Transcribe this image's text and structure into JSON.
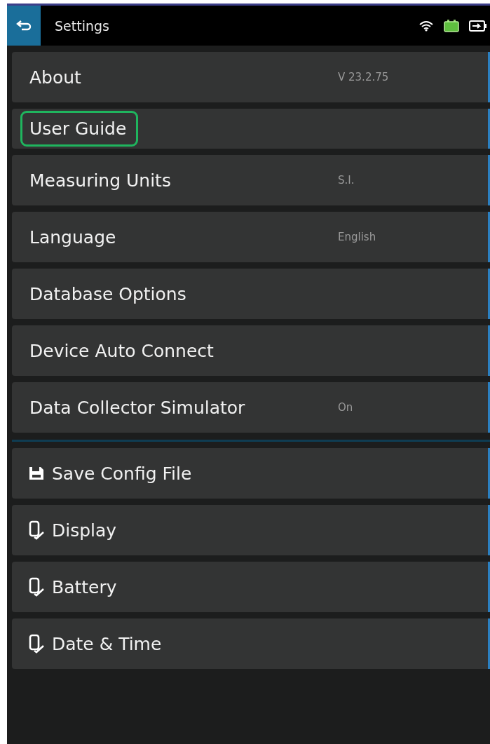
{
  "header": {
    "title": "Settings"
  },
  "settings": [
    {
      "label": "About",
      "value": "V 23.2.75",
      "selected": false
    },
    {
      "label": "User Guide",
      "selected": true
    },
    {
      "label": "Measuring Units",
      "value": "S.I.",
      "selected": false
    },
    {
      "label": "Language",
      "value": "English",
      "selected": false
    },
    {
      "label": "Database Options",
      "selected": false
    },
    {
      "label": "Device Auto Connect",
      "selected": false
    },
    {
      "label": "Data Collector Simulator",
      "value": "On",
      "selected": false
    }
  ],
  "actions": [
    {
      "label": "Save Config File",
      "kind": "save"
    },
    {
      "label": "Display",
      "kind": "device"
    },
    {
      "label": "Battery",
      "kind": "device"
    },
    {
      "label": "Date & Time",
      "kind": "device"
    }
  ]
}
